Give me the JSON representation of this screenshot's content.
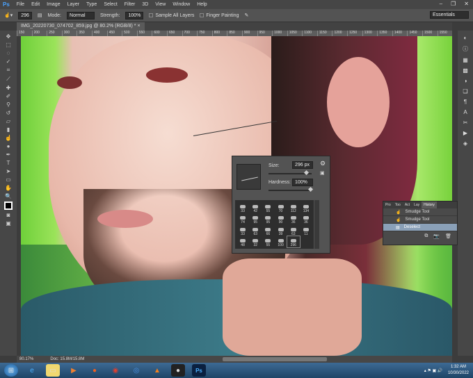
{
  "app": {
    "logo": "Ps"
  },
  "menu": [
    "File",
    "Edit",
    "Image",
    "Layer",
    "Type",
    "Select",
    "Filter",
    "3D",
    "View",
    "Window",
    "Help"
  ],
  "options": {
    "brush_size": "296",
    "mode_label": "Mode:",
    "mode_value": "Normal",
    "strength_label": "Strength:",
    "strength_value": "100%",
    "sample_all_layers": "Sample All Layers",
    "finger_painting": "Finger Painting",
    "workspace": "Essentials"
  },
  "document": {
    "tab_title": "IMG_20220730_074702_859.jpg @ 80.2% (RGB/8) *",
    "close": "×"
  },
  "ruler": [
    "150",
    "200",
    "250",
    "300",
    "350",
    "400",
    "450",
    "500",
    "550",
    "600",
    "650",
    "700",
    "750",
    "800",
    "850",
    "900",
    "950",
    "1000",
    "1050",
    "1100",
    "1150",
    "1200",
    "1250",
    "1300",
    "1350",
    "1400",
    "1450",
    "1500",
    "1550"
  ],
  "brush_panel": {
    "size_label": "Size:",
    "size_value": "296 px",
    "hardness_label": "Hardness:",
    "hardness_value": "100%",
    "size_fraction": 0.9,
    "hardness_fraction": 1.0,
    "presets": [
      "33",
      "42",
      "55",
      "70",
      "112",
      "134",
      "74",
      "95",
      "95",
      "90",
      "36",
      "36",
      "33",
      "63",
      "66",
      "39",
      "63",
      "11",
      "48",
      "32",
      "55",
      "100",
      "296"
    ]
  },
  "history": {
    "tabs": [
      "Pro",
      "Too",
      "Act",
      "Lay",
      "History"
    ],
    "items": [
      "Smudge Tool",
      "Smudge Tool",
      "Deselect"
    ],
    "selected": 2
  },
  "status": {
    "zoom": "80.17%",
    "doc": "Doc: 15.8M/15.8M"
  },
  "taskbar": {
    "time": "1:32 AM",
    "date": "10/30/2022"
  }
}
